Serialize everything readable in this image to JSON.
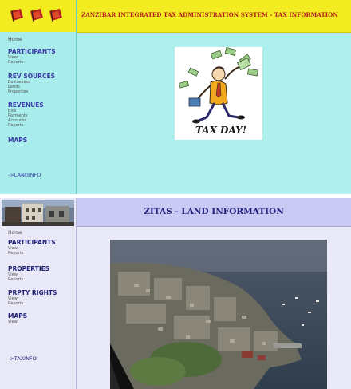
{
  "top_panel": {
    "header_title": "ZANZIBAR INTEGRATED TAX ADMINISTRATION SYSTEM - TAX INFORMATION",
    "sidebar": {
      "home": "Home",
      "participants": {
        "heading": "PARTICIPANTS",
        "items": [
          "View",
          "Reports"
        ]
      },
      "rev_sources": {
        "heading": "REV SOURCES",
        "items": [
          "Businesses",
          "Lands",
          "Properties"
        ]
      },
      "revenues": {
        "heading": "REVENUES",
        "items": [
          "Bills",
          "Payments",
          "Accounts",
          "Reports"
        ]
      },
      "maps": {
        "heading": "MAPS"
      },
      "switch_link": "->LANDINFO"
    },
    "illustration_caption": "TAX DAY!",
    "colors": {
      "header_bg": "#f2ec21",
      "header_text": "#b41d1d",
      "sidebar_bg": "#a9ecec",
      "main_bg": "#aeefee",
      "nav_heading": "#3a3aa8"
    },
    "icons": [
      "flag-icon",
      "flag-icon",
      "flag-icon",
      "tax-day-illustration"
    ]
  },
  "bottom_panel": {
    "header_title": "ZITAS - LAND INFORMATION",
    "sidebar": {
      "home": "Home",
      "participants": {
        "heading": "PARTICIPANTS",
        "items": [
          "View",
          "Reports"
        ]
      },
      "properties": {
        "heading": "PROPERTIES",
        "items": [
          "View",
          "Reports"
        ]
      },
      "prpty_rights": {
        "heading": "PRPTY RIGHTS",
        "items": [
          "View",
          "Reports"
        ]
      },
      "maps": {
        "heading": "MAPS",
        "items": [
          "View"
        ]
      },
      "switch_link": "->TAXINFO"
    },
    "colors": {
      "header_bg": "#c9c9f3",
      "header_text": "#22227d",
      "sidebar_bg": "#e8e8f6",
      "main_bg": "#e9e9f8"
    },
    "icons": [
      "building-photo",
      "aerial-city-photo"
    ]
  }
}
